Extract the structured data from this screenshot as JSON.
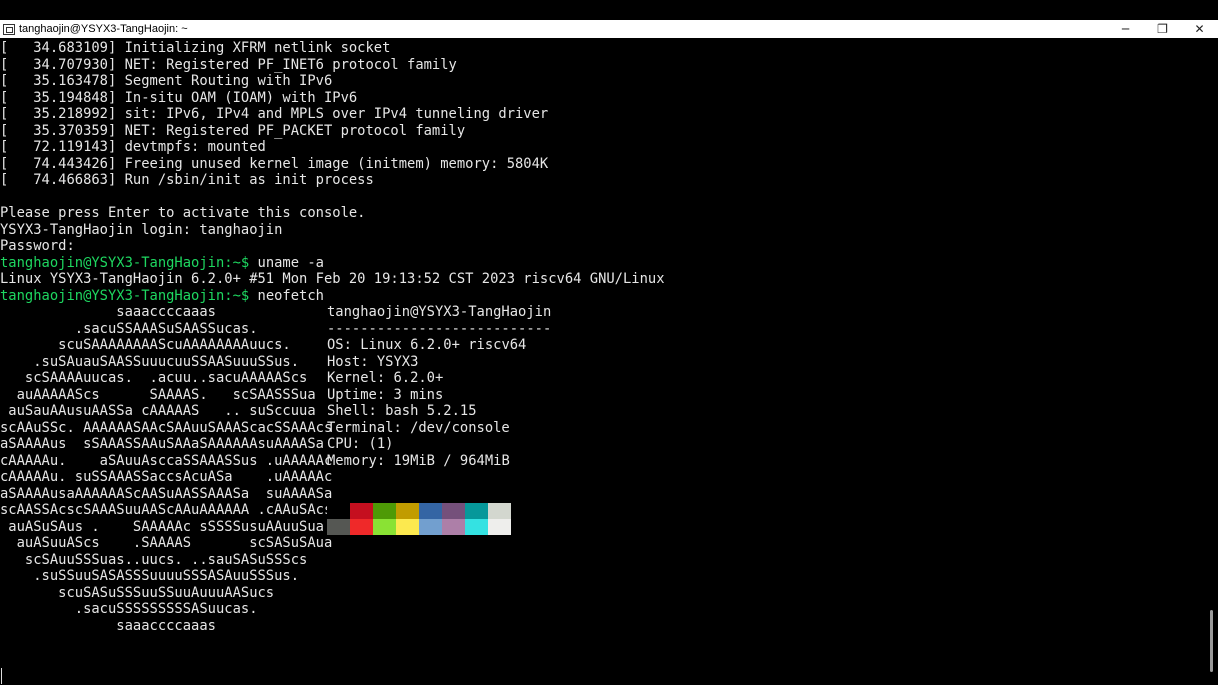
{
  "window": {
    "title": "tanghaojin@YSYX3-TangHaojin: ~",
    "controls": {
      "minimize": "─",
      "restore": "❐",
      "close": "✕"
    }
  },
  "terminal": {
    "kernel_log": [
      "[   34.683109] Initializing XFRM netlink socket",
      "[   34.707930] NET: Registered PF_INET6 protocol family",
      "[   35.163478] Segment Routing with IPv6",
      "[   35.194848] In-situ OAM (IOAM) with IPv6",
      "[   35.218992] sit: IPv6, IPv4 and MPLS over IPv4 tunneling driver",
      "[   35.370359] NET: Registered PF_PACKET protocol family",
      "[   72.119143] devtmpfs: mounted",
      "[   74.443426] Freeing unused kernel image (initmem) memory: 5804K",
      "[   74.466863] Run /sbin/init as init process"
    ],
    "console_prompt": "Please press Enter to activate this console.",
    "login_line": "YSYX3-TangHaojin login: tanghaojin",
    "password_line": "Password:",
    "prompt": "tanghaojin@YSYX3-TangHaojin:~$",
    "cmd1": " uname -a",
    "uname_output": "Linux YSYX3-TangHaojin 6.2.0+ #51 Mon Feb 20 19:13:52 CST 2023 riscv64 GNU/Linux",
    "cmd2": " neofetch"
  },
  "neofetch": {
    "logo": [
      "              saaaccccaaas",
      "         .sacuSSAAASuSAASSucas.",
      "       scuSAAAAAAAAScuAAAAAAAAuucs.",
      "    .suSAuauSAASSuuucuuSSAASuuuSSus.",
      "   scSAAAAuucas.  .acuu..sacuAAAAAScs",
      "  auAAAAAScs      SAAAAS.   scSAASSSua",
      " auSauAAusuAASSa cAAAAAS   .. suSccuua",
      "scAAuSSc. AAAAAASAAcSAAuuSAAAScacSSAAAcs",
      "aSAAAAus  sSAAASSAAuSAAaSAAAAAAsuAAAASa",
      "cAAAAAu.    aSAuuAsccaSSAAASSus .uAAAAAc",
      "cAAAAAu. suSSAAASSaccsAcuASa    .uAAAAAc",
      "aSAAAAusaAAAAAAScAASuAASSAAASa  suAAAASa",
      "scAASSAcscSAAASuuAAScAAuAAAAAA .cAAuSAcs",
      " auASuSAus .    SAAAAAc sSSSSusuAAuuSua",
      "  auASuuAScs    .SAAAAS       scSASuSAua",
      "   scSAuuSSSuas..uucs. ..sauSASuSSScs",
      "    .suSSuuSASASSSuuuuSSSASAuuSSSus.",
      "       scuSASuSSSuuSSuuAuuuAASucs",
      "         .sacuSSSSSSSSSASuucas.",
      "              saaaccccaaas"
    ],
    "header": "tanghaojin@YSYX3-TangHaojin",
    "separator": "---------------------------",
    "info": [
      {
        "key": "OS",
        "value": ": Linux 6.2.0+ riscv64"
      },
      {
        "key": "Host",
        "value": ": YSYX3"
      },
      {
        "key": "Kernel",
        "value": ": 6.2.0+"
      },
      {
        "key": "Uptime",
        "value": ": 3 mins"
      },
      {
        "key": "Shell",
        "value": ": bash 5.2.15"
      },
      {
        "key": "Terminal",
        "value": ": /dev/console"
      },
      {
        "key": "CPU",
        "value": ": (1)"
      },
      {
        "key": "Memory",
        "value": ": 19MiB / 964MiB"
      }
    ],
    "palette": [
      "#000000",
      "#c50f1f",
      "#4e9a06",
      "#c19c00",
      "#3465a4",
      "#75507b",
      "#06989a",
      "#d3d7cf",
      "#555753",
      "#ef2929",
      "#8ae234",
      "#fce94f",
      "#729fcf",
      "#ad7fa8",
      "#34e2e2",
      "#eeeeec"
    ]
  },
  "colors": {
    "prompt_green": "#1ed760",
    "text": "#e6e6e6",
    "background": "#000000",
    "titlebar": "#ffffff"
  }
}
